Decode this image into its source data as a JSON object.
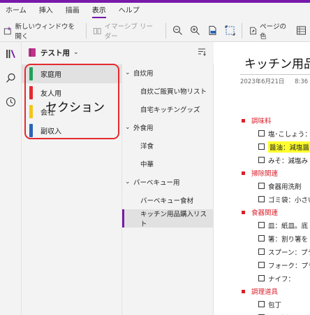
{
  "ribbon": {
    "tabs": [
      {
        "label": "ホーム",
        "active": false
      },
      {
        "label": "挿入",
        "active": false
      },
      {
        "label": "描画",
        "active": false
      },
      {
        "label": "表示",
        "active": true
      },
      {
        "label": "ヘルプ",
        "active": false
      }
    ],
    "new_window_label": "新しいウィンドウを開く",
    "immersive_reader_label": "イマーシブ リーダー",
    "page_color_label": "ページの色"
  },
  "notebook": {
    "name": "テスト用"
  },
  "sections": [
    {
      "label": "家庭用",
      "color": "#22a05a",
      "selected": true
    },
    {
      "label": "友人用",
      "color": "#e5292f",
      "selected": false
    },
    {
      "label": "会社",
      "color": "#f5c518",
      "selected": false
    },
    {
      "label": "副収入",
      "color": "#2a63b8",
      "selected": false
    }
  ],
  "annotation": {
    "label": "セクション"
  },
  "pages": [
    {
      "type": "group",
      "label": "自炊用"
    },
    {
      "type": "page",
      "label": "自炊ご飯買い物リスト"
    },
    {
      "type": "page",
      "label": "自宅キッチングッズ"
    },
    {
      "type": "group",
      "label": "外食用"
    },
    {
      "type": "page",
      "label": "洋食"
    },
    {
      "type": "page",
      "label": "中華"
    },
    {
      "type": "group",
      "label": "バーベキュー用"
    },
    {
      "type": "page",
      "label": "バーベキュー食材"
    },
    {
      "type": "page",
      "label": "キッチン用品購入リスト",
      "selected": true
    }
  ],
  "content": {
    "title": "キッチン用品",
    "date": "2023年6月21日",
    "time": "8:36",
    "items": [
      {
        "kind": "cat",
        "text": "調味料"
      },
      {
        "kind": "todo",
        "text": "塩･こしょう：ブ"
      },
      {
        "kind": "todo",
        "text": "醤油：減塩醤",
        "highlight": true
      },
      {
        "kind": "todo",
        "text": "みそ：減塩み"
      },
      {
        "kind": "cat",
        "text": "掃除関連"
      },
      {
        "kind": "todo",
        "text": "食器用洗剤"
      },
      {
        "kind": "todo",
        "text": "ゴミ袋：小さい"
      },
      {
        "kind": "cat",
        "text": "食器関連"
      },
      {
        "kind": "todo",
        "text": "皿：紙皿。底"
      },
      {
        "kind": "todo",
        "text": "箸：割り箸を"
      },
      {
        "kind": "todo",
        "text": "スプーン：プラ"
      },
      {
        "kind": "todo",
        "text": "フォーク：プラ"
      },
      {
        "kind": "todo",
        "text": "ナイフ："
      },
      {
        "kind": "cat",
        "text": "調理道具"
      },
      {
        "kind": "todo",
        "text": "包丁"
      },
      {
        "kind": "todo",
        "text": "まな板"
      }
    ]
  },
  "colors": {
    "accent": "#7719aa",
    "annotation": "#e5292f",
    "category": "#d9212a",
    "highlight": "#ffff2e"
  }
}
